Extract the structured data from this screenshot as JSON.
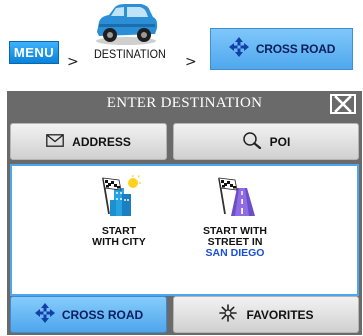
{
  "breadcrumb": {
    "menu": "MENU",
    "separator": ">",
    "destination": "DESTINATION",
    "current": "CROSS ROAD"
  },
  "dialog": {
    "title": "ENTER DESTINATION",
    "buttons": {
      "address": "ADDRESS",
      "poi": "POI",
      "cross_road": "CROSS ROAD",
      "favorites": "FAVORITES"
    },
    "options": [
      {
        "line1": "START",
        "line2": "WITH CITY",
        "icon": "city-flag-icon"
      },
      {
        "line1": "START WITH",
        "line2": "STREET IN",
        "line3": "SAN DIEGO",
        "icon": "street-flag-icon"
      }
    ]
  },
  "colors": {
    "menu_blue": "#0a82d8",
    "button_blue": "#4ea6ec",
    "dialog_gray": "#6a6a6a",
    "highlight_text": "#1a4fd6",
    "car_blue": "#2a8fd6"
  }
}
